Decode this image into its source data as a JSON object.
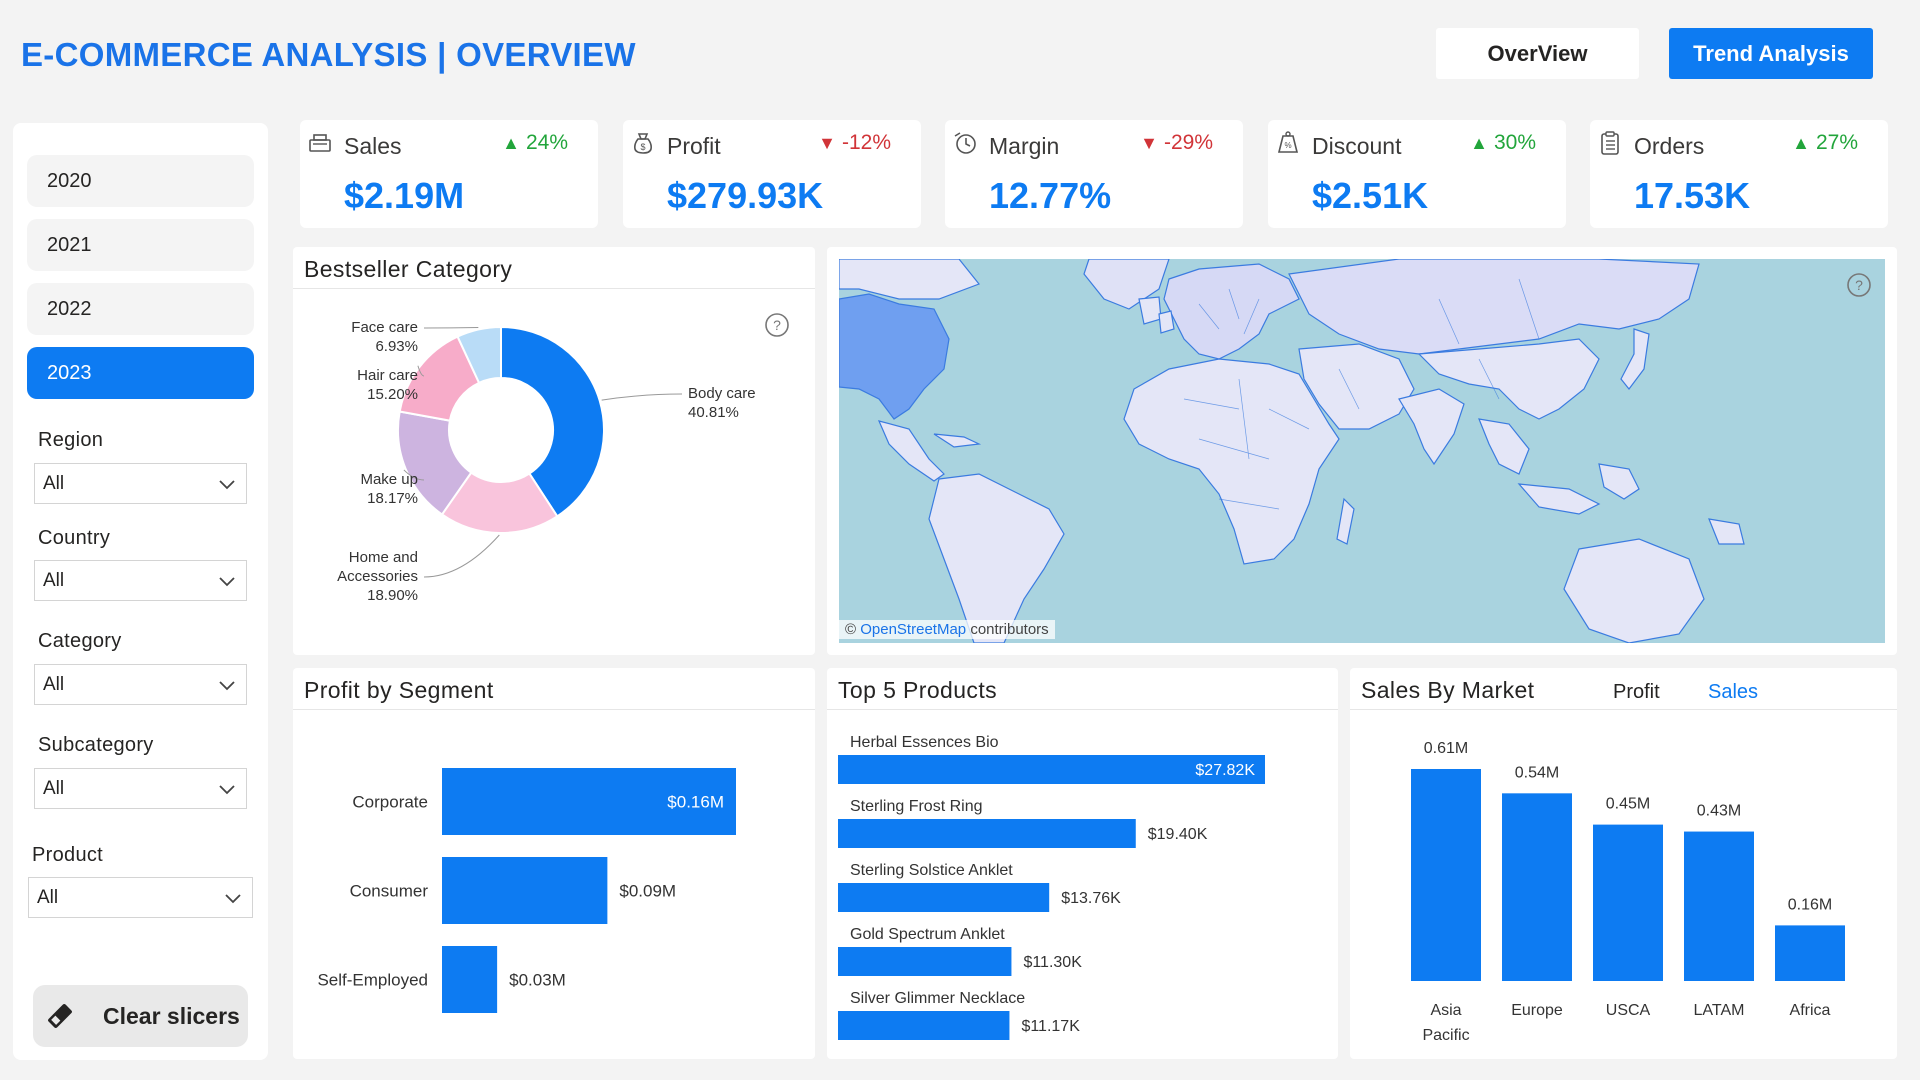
{
  "header": {
    "title": "E-COMMERCE ANALYSIS | OVERVIEW",
    "nav": {
      "overview": "OverView",
      "trend": "Trend Analysis"
    }
  },
  "sidebar": {
    "years": [
      "2020",
      "2021",
      "2022",
      "2023"
    ],
    "active_year": "2023",
    "slicers": [
      {
        "label": "Region",
        "value": "All"
      },
      {
        "label": "Country",
        "value": "All"
      },
      {
        "label": "Category",
        "value": "All"
      },
      {
        "label": "Subcategory",
        "value": "All"
      },
      {
        "label": "Product",
        "value": "All"
      }
    ],
    "clear_label": "Clear slicers"
  },
  "kpis": [
    {
      "label": "Sales",
      "value": "$2.19M",
      "change": "24%",
      "direction": "up",
      "icon": "sales-register-icon"
    },
    {
      "label": "Profit",
      "value": "$279.93K",
      "change": "-12%",
      "direction": "down",
      "icon": "money-bag-icon"
    },
    {
      "label": "Margin",
      "value": "12.77%",
      "change": "-29%",
      "direction": "down",
      "icon": "margin-clock-icon"
    },
    {
      "label": "Discount",
      "value": "$2.51K",
      "change": "30%",
      "direction": "up",
      "icon": "discount-tag-icon"
    },
    {
      "label": "Orders",
      "value": "17.53K",
      "change": "27%",
      "direction": "up",
      "icon": "clipboard-icon"
    }
  ],
  "colors": {
    "accent": "#0d7bf2",
    "up": "#22a53b",
    "down": "#d13438",
    "donut": [
      "#0d7bf2",
      "#f9c4dc",
      "#cdb4e0",
      "#f7acc9",
      "#b9dcf7"
    ]
  },
  "bestseller": {
    "title": "Bestseller Category",
    "chart_data": {
      "type": "pie",
      "categories": [
        "Body care",
        "Home and Accessories",
        "Make up",
        "Hair care",
        "Face care"
      ],
      "values": [
        40.81,
        18.9,
        18.17,
        15.2,
        6.93
      ],
      "labels": [
        "40.81%",
        "18.90%",
        "18.17%",
        "15.20%",
        "6.93%"
      ]
    }
  },
  "map": {
    "attribution_symbol": "©",
    "attribution_link": "OpenStreetMap",
    "attribution_rest": "contributors"
  },
  "profit_by_segment": {
    "title": "Profit by Segment",
    "chart_data": {
      "type": "bar",
      "orientation": "horizontal",
      "categories": [
        "Corporate",
        "Consumer",
        "Self-Employed"
      ],
      "values": [
        0.16,
        0.09,
        0.03
      ],
      "labels": [
        "$0.16M",
        "$0.09M",
        "$0.03M"
      ],
      "unit": "$M"
    }
  },
  "top_products": {
    "title": "Top 5 Products",
    "chart_data": {
      "type": "bar",
      "orientation": "horizontal",
      "categories": [
        "Herbal Essences Bio",
        "Sterling Frost Ring",
        "Sterling Solstice Anklet",
        "Gold Spectrum Anklet",
        "Silver Glimmer Necklace"
      ],
      "values": [
        27.82,
        19.4,
        13.76,
        11.3,
        11.17
      ],
      "labels": [
        "$27.82K",
        "$19.40K",
        "$13.76K",
        "$11.30K",
        "$11.17K"
      ],
      "unit": "$K"
    }
  },
  "sales_by_market": {
    "title": "Sales By Market",
    "toggle": [
      "Profit",
      "Sales"
    ],
    "active_toggle": "Sales",
    "chart_data": {
      "type": "bar",
      "categories": [
        "Asia Pacific",
        "Europe",
        "USCA",
        "LATAM",
        "Africa"
      ],
      "values": [
        0.61,
        0.54,
        0.45,
        0.43,
        0.16
      ],
      "labels": [
        "0.61M",
        "0.54M",
        "0.45M",
        "0.43M",
        "0.16M"
      ],
      "unit": "M"
    }
  }
}
